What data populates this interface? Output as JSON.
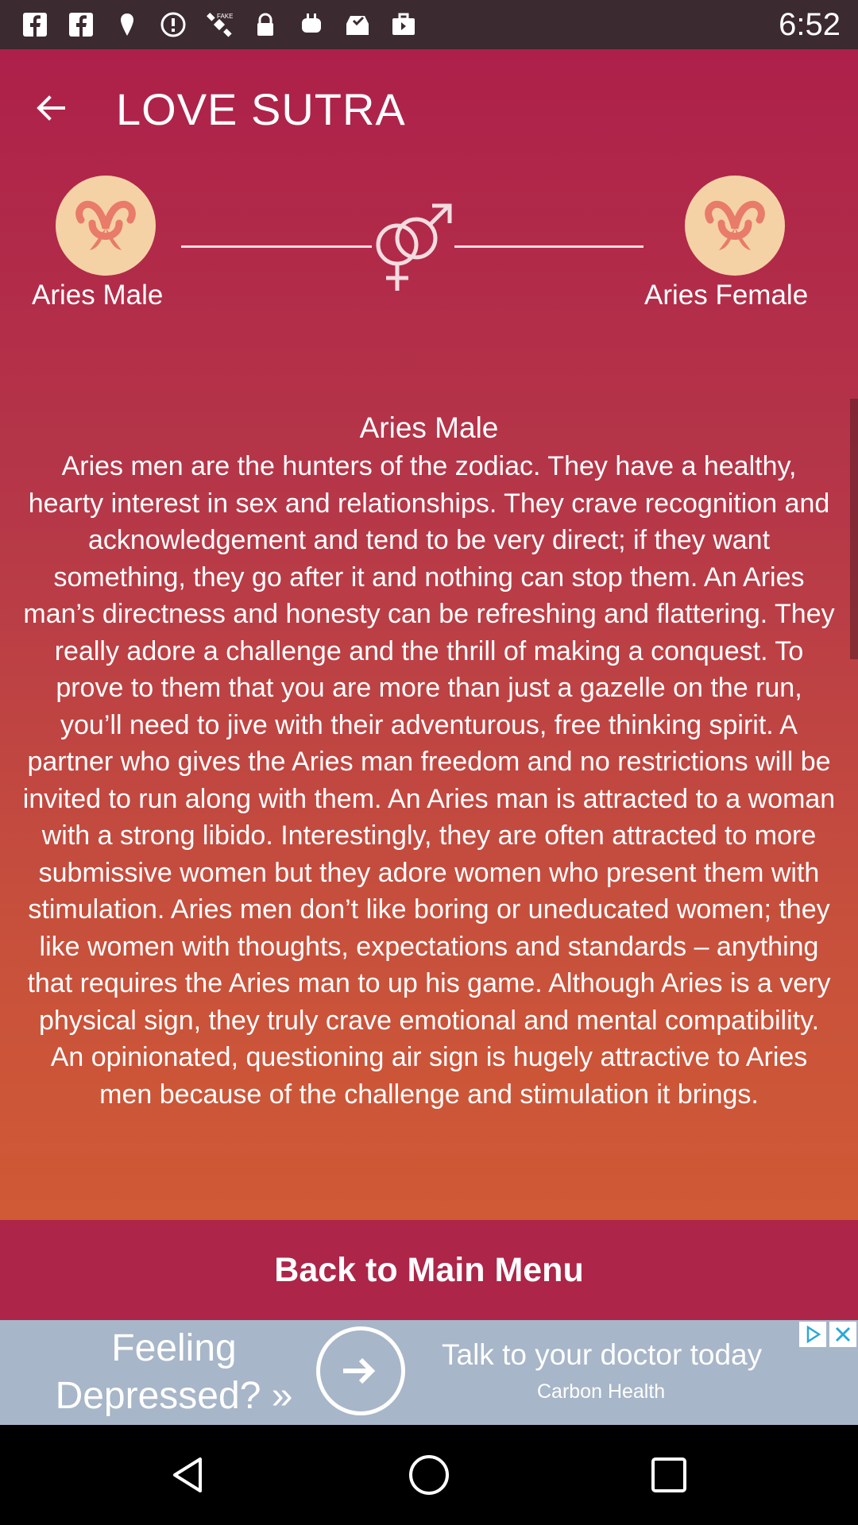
{
  "status_bar": {
    "time": "6:52",
    "icons": [
      "facebook-icon",
      "facebook-icon",
      "location-pin-icon",
      "alert-icon",
      "satellite-icon",
      "lock-icon",
      "android-robot-icon",
      "inbox-icon",
      "briefcase-icon"
    ]
  },
  "toolbar": {
    "title": "LOVE SUTRA"
  },
  "match": {
    "left_label": "Aries Male",
    "right_label": "Aries Female"
  },
  "content": {
    "heading": "Aries Male",
    "body": "Aries men are the hunters of the zodiac. They have a healthy, hearty interest in sex and relationships. They crave recognition and acknowledgement and tend to be very direct; if they want something, they go after it and nothing can stop them. An Aries man’s directness and honesty can be refreshing and flattering. They really adore a challenge and the thrill of making a conquest. To prove to them that you are more than just a gazelle on the run, you’ll need to jive with their adventurous, free thinking spirit. A partner who gives the Aries man freedom and no restrictions will be invited to run along with them. An Aries man is attracted to a woman with a strong libido. Interestingly, they are often attracted to more submissive women but they adore women who present them with stimulation. Aries men don’t like boring or uneducated women; they like women with thoughts, expectations and standards – anything that requires the Aries man to up his game. Although Aries is a very physical sign, they truly crave emotional and mental compatibility. An opinionated, questioning air sign is hugely attractive to Aries men because of the challenge and stimulation it brings."
  },
  "menu_button": {
    "label": "Back to Main Menu"
  },
  "ad": {
    "left_line1": "Feeling",
    "left_line2": "Depressed? »",
    "right_title": "Talk to your doctor today",
    "right_sub": "Carbon Health"
  },
  "colors": {
    "header": "#ad204a",
    "gradient_end": "#d05a35",
    "button": "#ad2548",
    "sign_circle": "#f5d2a5",
    "sign_glyph": "#e87b6a",
    "ad_background": "#a7b6c8"
  }
}
